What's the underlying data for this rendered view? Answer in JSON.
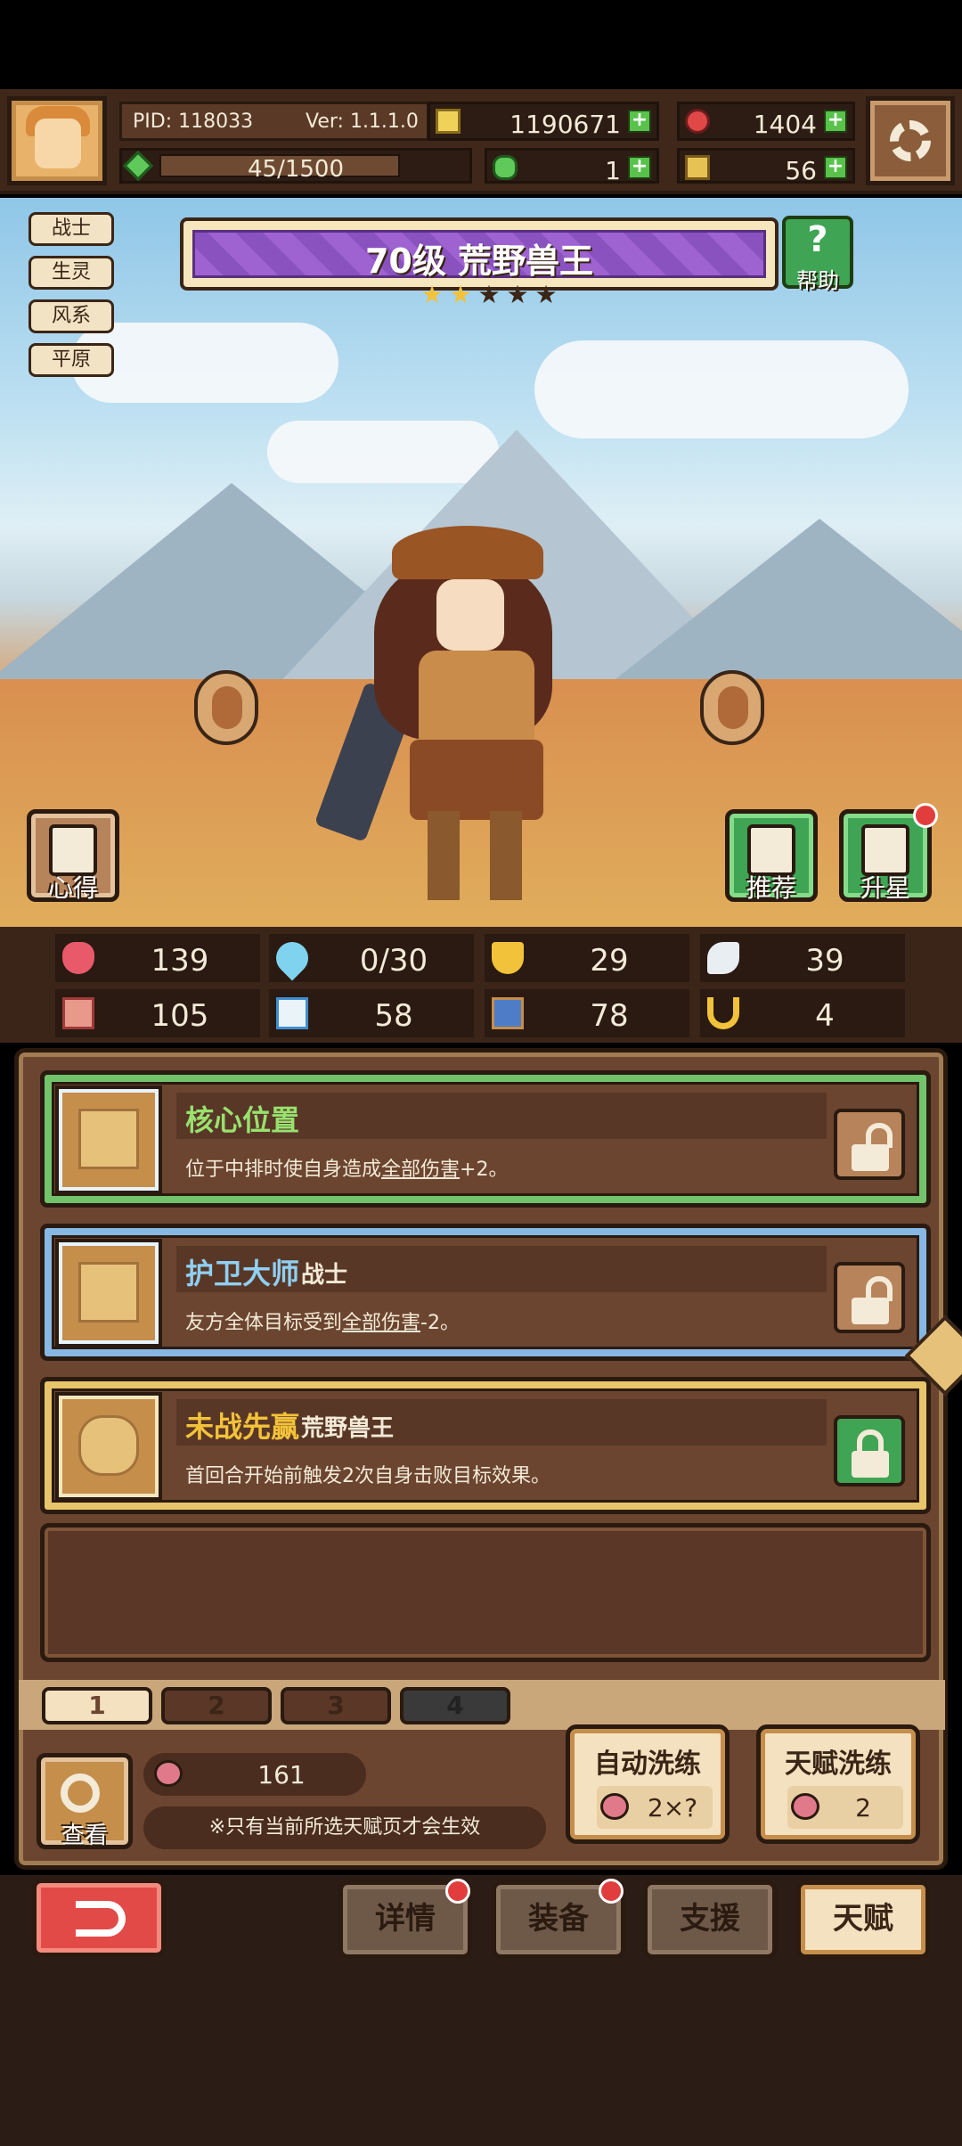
{
  "header": {
    "pid": "PID: 118033",
    "version": "Ver: 1.1.1.0",
    "gold": "1190671",
    "gems": "1404",
    "exp": "45/1500",
    "exp_fraction": 0.03,
    "clover": "1",
    "shards": "56"
  },
  "tags": [
    "战士",
    "生灵",
    "风系",
    "平原"
  ],
  "hero": {
    "title": "70级  荒野兽王",
    "stars_total": 5,
    "stars_on": 2,
    "help_label": "帮助"
  },
  "scene_buttons": {
    "xinde": "心得",
    "tuijian": "推荐",
    "shengxing": "升星"
  },
  "stats": [
    {
      "icon": "heart-icon",
      "value": "139"
    },
    {
      "icon": "water-drop-icon",
      "value": "0/30"
    },
    {
      "icon": "shield-icon",
      "value": "29"
    },
    {
      "icon": "wing-icon",
      "value": "39"
    },
    {
      "icon": "fist-icon",
      "value": "105"
    },
    {
      "icon": "book-icon",
      "value": "58"
    },
    {
      "icon": "armor-icon",
      "value": "78"
    },
    {
      "icon": "horseshoe-icon",
      "value": "4"
    }
  ],
  "talents": [
    {
      "name": "核心位置",
      "tag": "",
      "desc_pre": "位于中排时使自身造成",
      "desc_link": "全部伤害",
      "desc_post": "+2。",
      "locked": false
    },
    {
      "name": "护卫大师",
      "tag": "战士",
      "desc_pre": "友方全体目标受到",
      "desc_link": "全部伤害",
      "desc_post": "-2。",
      "locked": false
    },
    {
      "name": "未战先赢",
      "tag": "荒野兽王",
      "desc_pre": "首回合开始前触发2次自身击败目标效果。",
      "desc_link": "",
      "desc_post": "",
      "locked": true
    }
  ],
  "pages": [
    "1",
    "2",
    "3",
    "4"
  ],
  "view_label": "查看",
  "peach_count": "161",
  "hint": "※只有当前所选天赋页才会生效",
  "auto_wash": {
    "label": "自动洗练",
    "cost": "2×?"
  },
  "talent_wash": {
    "label": "天赋洗练",
    "cost": "2"
  },
  "nav": [
    "详情",
    "装备",
    "支援",
    "天赋"
  ],
  "colors": {
    "accent_green": "#3fa453",
    "accent_red": "#e24a48",
    "panel_brown": "#6b4530",
    "gold_text": "#f2c23a"
  }
}
